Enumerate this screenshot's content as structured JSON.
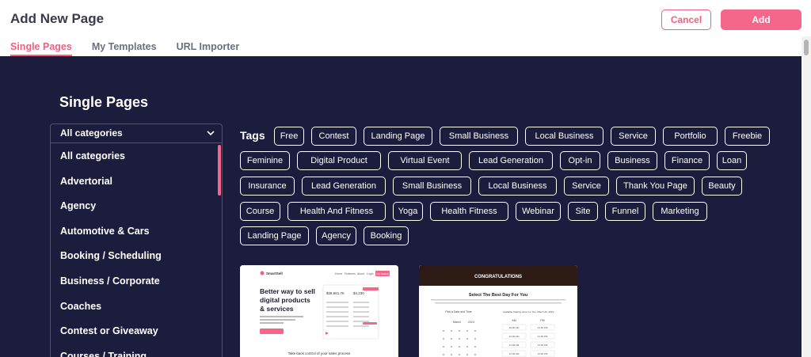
{
  "header": {
    "title": "Add New Page",
    "cancel_label": "Cancel",
    "add_label": "Add"
  },
  "tabs": [
    {
      "label": "Single Pages",
      "active": true
    },
    {
      "label": "My Templates",
      "active": false
    },
    {
      "label": "URL Importer",
      "active": false
    }
  ],
  "section_title": "Single Pages",
  "categories": {
    "selected": "All categories",
    "items": [
      "All categories",
      "Advertorial",
      "Agency",
      "Automotive & Cars",
      "Booking / Scheduling",
      "Business / Corporate",
      "Coaches",
      "Contest or Giveaway",
      "Courses / Training"
    ]
  },
  "tags_label": "Tags",
  "tags": [
    [
      "Free",
      "Contest",
      "Landing Page",
      "Small Business",
      "Local Business",
      "Service",
      "Portfolio",
      "Freebie"
    ],
    [
      "Feminine",
      "Digital Product",
      "Virtual Event",
      "Lead Generation",
      "Opt-in",
      "Business",
      "Finance",
      "Loan"
    ],
    [
      "Insurance",
      "Lead Generation",
      "Small Business",
      "Local Business",
      "Service",
      "Thank You Page",
      "Beauty"
    ],
    [
      "Course",
      "Health And Fitness",
      "Yoga",
      "Health Fitness",
      "Webinar",
      "Site",
      "Funnel",
      "Marketing"
    ],
    [
      "Landing Page",
      "Agency",
      "Booking"
    ]
  ],
  "templates": [
    {
      "brand": "SmartSell",
      "nav": [
        "Home",
        "Features",
        "About",
        "Login"
      ],
      "nav_cta": "Get Started",
      "headline": "Better way to sell digital products & services",
      "subtext": "Your Complete Digital Products and Services Online Store Solution",
      "cta": "Get Started - It's Free",
      "stat_a": "$38,661.76",
      "stat_b": "$4,230",
      "footer": "Take back control of your sales process"
    },
    {
      "banner": "CONGRATULATIONS",
      "heading": "Select The Best Day For You",
      "left_label": "Pick a Date and Time",
      "right_label": "Available Starting times for Thu, March 26, 2024",
      "month": "March",
      "year": "2024",
      "col_am": "AM",
      "col_pm": "PM",
      "am_times": [
        "09:00 AM",
        "10:00 AM",
        "11:00 AM",
        "12:00 AM"
      ],
      "pm_times": [
        "12:00 PM",
        "01:00 PM",
        "13:00 PM",
        "14:00 PM"
      ]
    }
  ],
  "colors": {
    "accent": "#f06080",
    "add_button": "#f4668a",
    "panel_bg": "#1c1c3c",
    "title_text": "#3a3a4a"
  }
}
